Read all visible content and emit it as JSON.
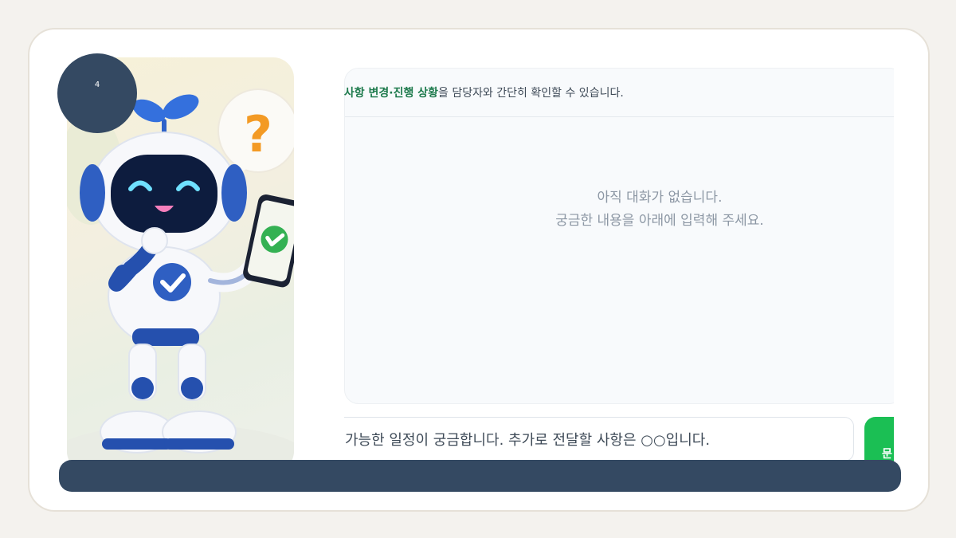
{
  "step": {
    "number": "4"
  },
  "illustration": {
    "alt": "",
    "icons": [
      "robot-mascot",
      "question-mark-icon",
      "check-icon",
      "smartphone"
    ]
  },
  "notice": {
    "highlight": "청사항 변경·진행 상황",
    "text": "을 담당자와 간단히 확인할 수 있습니다."
  },
  "empty_state": {
    "line1": "아직 대화가 없습니다.",
    "line2": "궁금한 내용을 아래에 입력해 주세요."
  },
  "input": {
    "placeholder": "가능한 일정이 궁금합니다. 추가로 전달할 사항은 ○○입니다."
  },
  "send_button": {
    "label": "문"
  },
  "colors": {
    "accent_green": "#1bbf54",
    "highlight_green": "#1d7a4c",
    "navy": "#344962",
    "page_bg": "#f4f2ee"
  }
}
